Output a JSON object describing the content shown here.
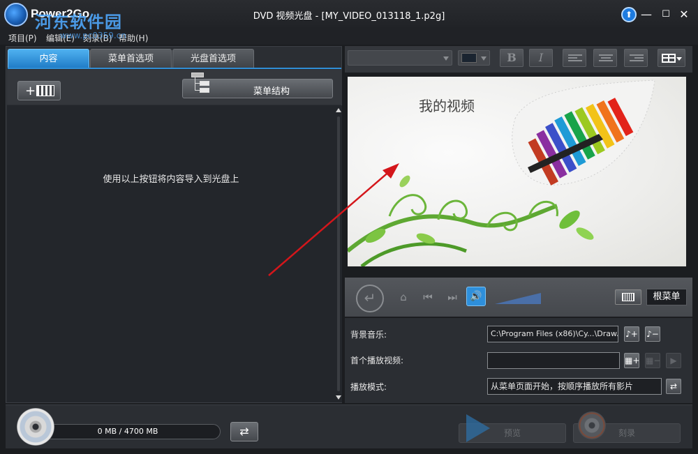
{
  "app": {
    "name": "Power2Go",
    "window_title": "DVD 视频光盘 - [MY_VIDEO_013118_1.p2g]",
    "watermark": "河东软件园",
    "watermark_sub": "www.pc0359.cn"
  },
  "menu": {
    "items": [
      "项目(P)",
      "编辑(E)",
      "刻录(B)",
      "帮助(H)"
    ]
  },
  "left_panel": {
    "tabs": [
      "内容",
      "菜单首选项",
      "光盘首选项"
    ],
    "active_tab": "内容",
    "menu_structure_label": "菜单结构",
    "empty_hint": "使用以上按钮将内容导入到光盘上"
  },
  "preview": {
    "menu_title": "我的视频"
  },
  "playback": {
    "root_menu_label": "根菜单"
  },
  "settings": {
    "bgm_label": "背景音乐:",
    "bgm_value": "C:\\Program Files (x86)\\Cy...\\Draw.wma",
    "first_video_label": "首个播放视频:",
    "first_video_value": "",
    "play_mode_label": "播放模式:",
    "play_mode_value": "从菜单页面开始，按顺序播放所有影片"
  },
  "bottom": {
    "disc_usage": "0 MB / 4700 MB",
    "preview_label": "预览",
    "burn_label": "刻录"
  },
  "colors": {
    "accent": "#2e8fdb",
    "background": "#1b1d20",
    "panel": "#2b2e33",
    "annotation_arrow": "#d4161b"
  },
  "icons": {
    "upgrade": "upgrade-arrow-icon",
    "add_media": "add-media-icon",
    "menu_structure": "tree-structure-icon",
    "volume": "speaker-icon",
    "disc": "disc-icon"
  }
}
